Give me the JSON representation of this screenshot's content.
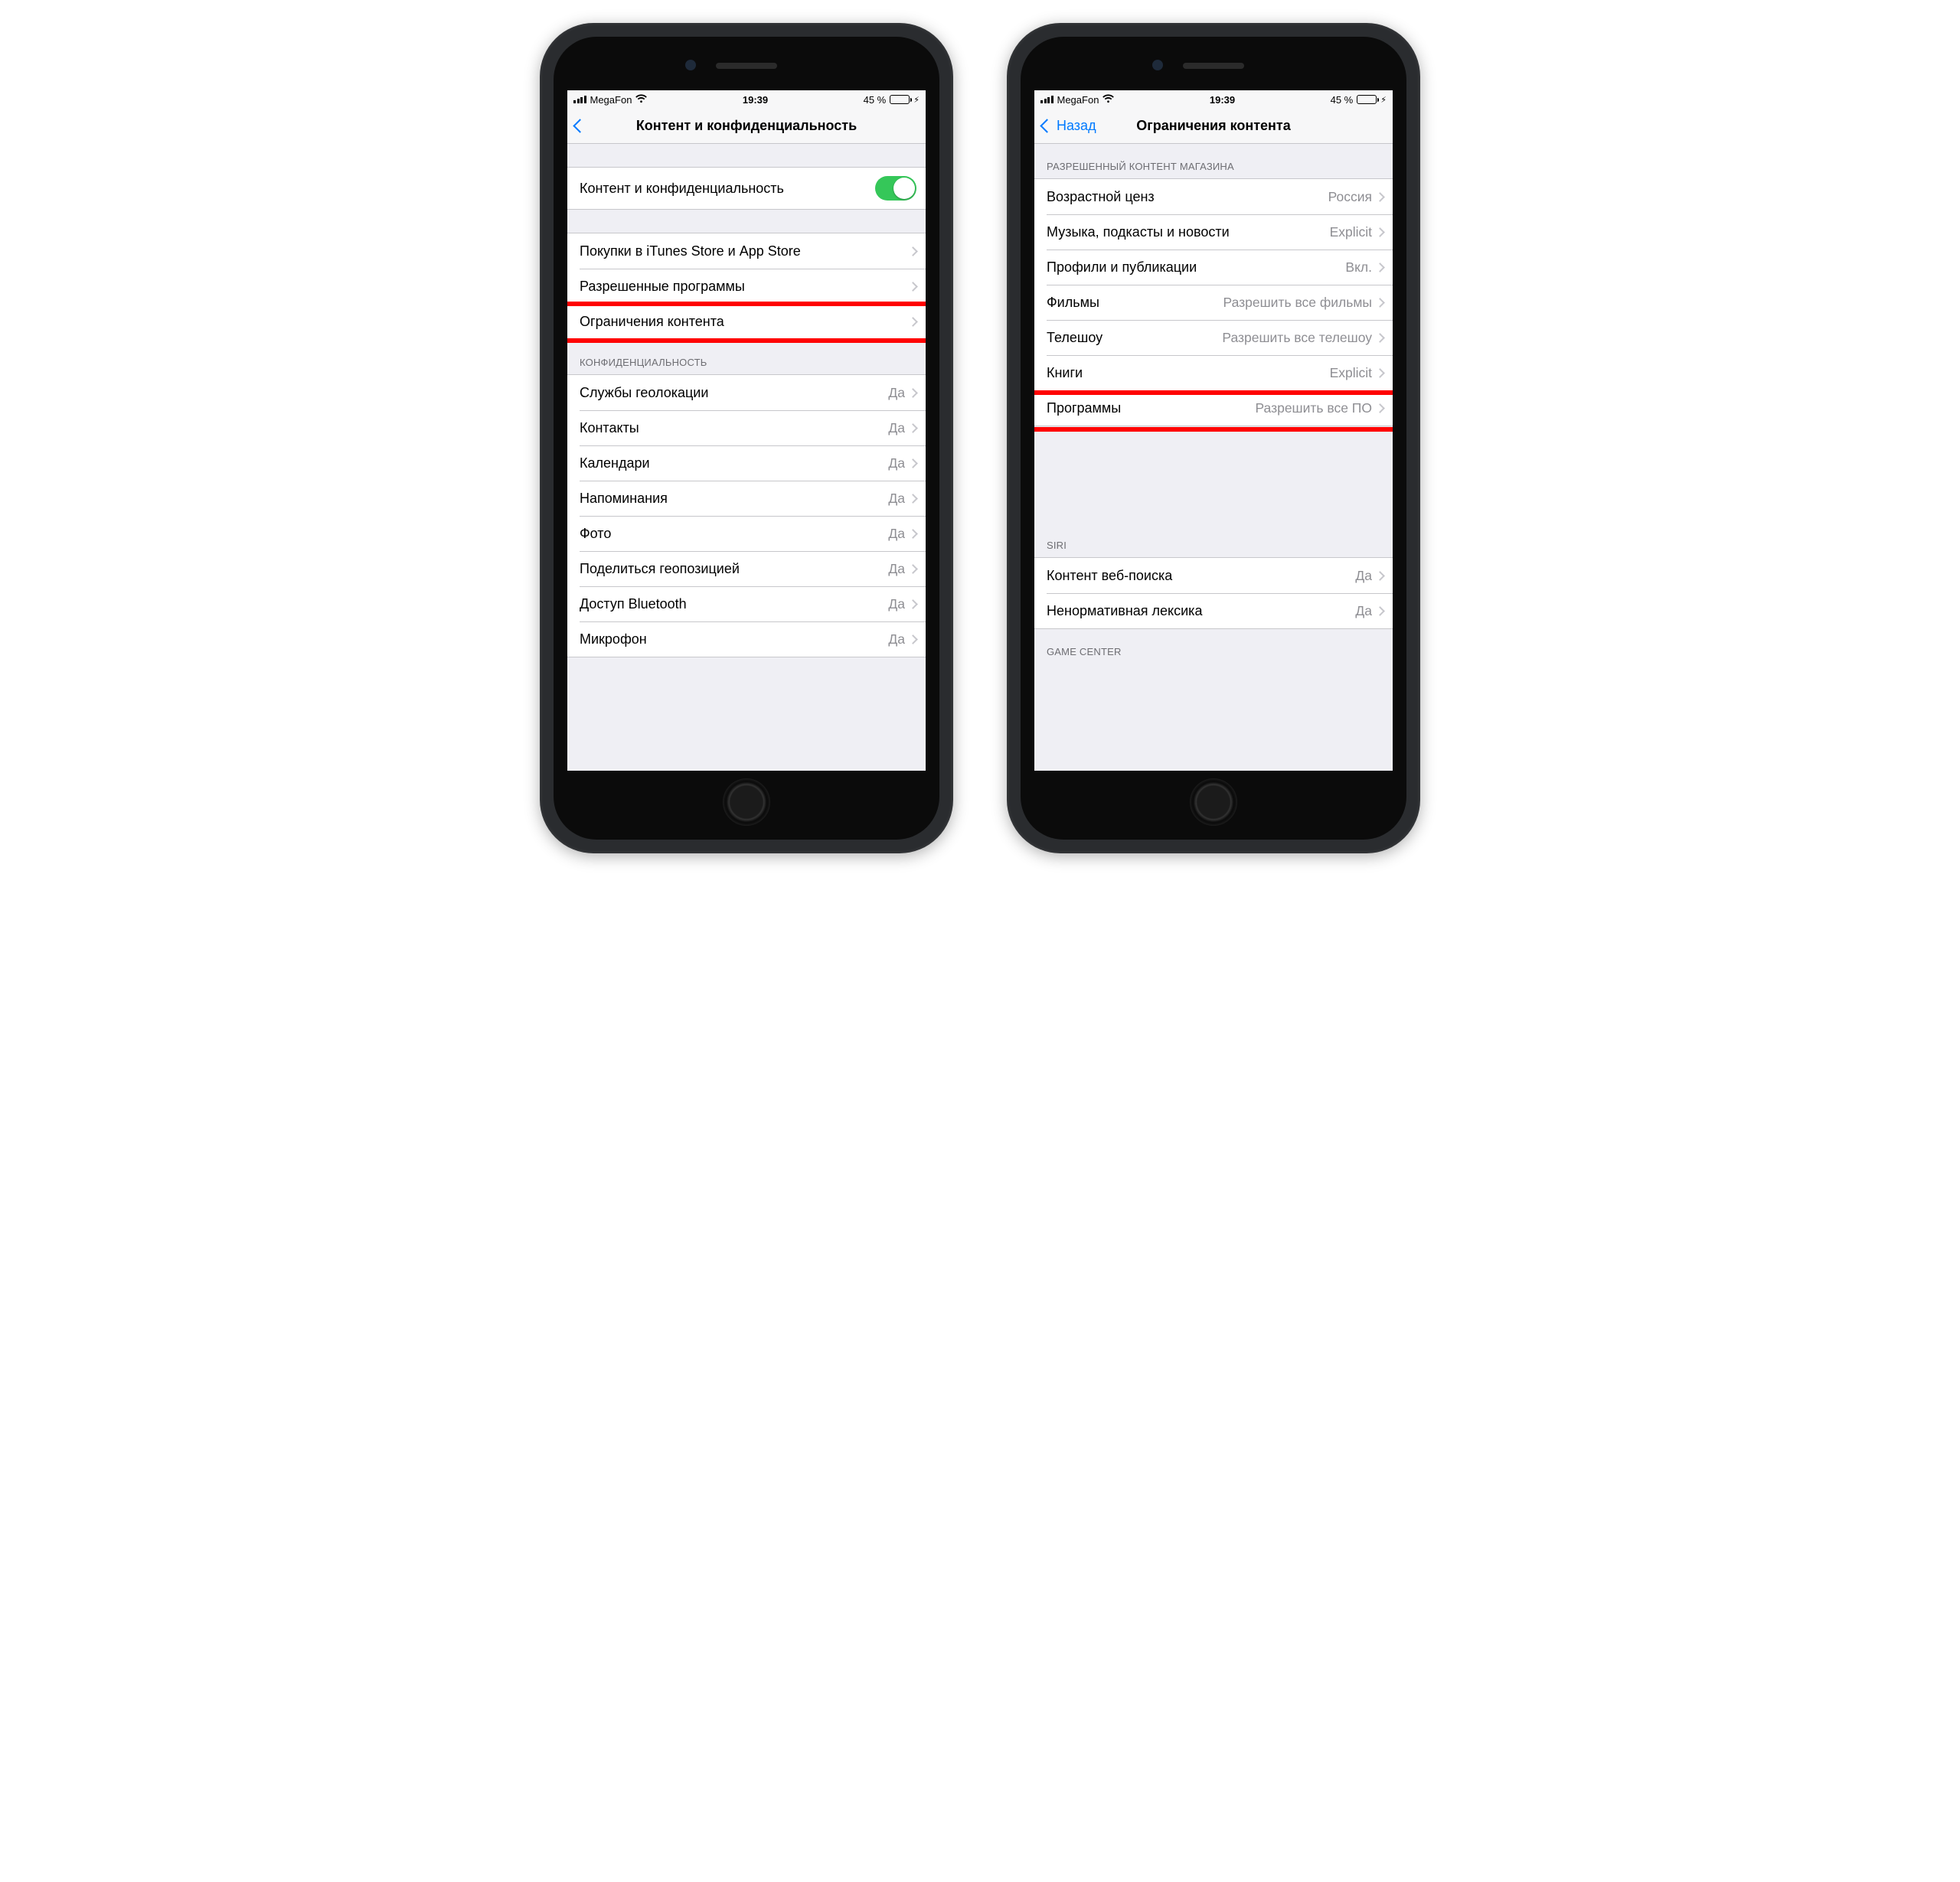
{
  "status": {
    "carrier": "MegaFon",
    "time": "19:39",
    "battery_pct": "45 %"
  },
  "left_phone": {
    "nav_title": "Контент и конфиденциальность",
    "toggle_row_label": "Контент и конфиденциальность",
    "group2": {
      "purchases": "Покупки в iTunes Store и App Store",
      "allowed_apps": "Разрешенные программы",
      "content_restrictions": "Ограничения контента"
    },
    "privacy_header": "КОНФИДЕНЦИАЛЬНОСТЬ",
    "privacy_rows": [
      {
        "label": "Службы геолокации",
        "value": "Да"
      },
      {
        "label": "Контакты",
        "value": "Да"
      },
      {
        "label": "Календари",
        "value": "Да"
      },
      {
        "label": "Напоминания",
        "value": "Да"
      },
      {
        "label": "Фото",
        "value": "Да"
      },
      {
        "label": "Поделиться геопозицией",
        "value": "Да"
      },
      {
        "label": "Доступ Bluetooth",
        "value": "Да"
      },
      {
        "label": "Микрофон",
        "value": "Да"
      }
    ]
  },
  "right_phone": {
    "back_label": "Назад",
    "nav_title": "Ограничения контента",
    "store_header": "РАЗРЕШЕННЫЙ КОНТЕНТ МАГАЗИНА",
    "store_rows": [
      {
        "label": "Возрастной ценз",
        "value": "Россия"
      },
      {
        "label": "Музыка, подкасты и новости",
        "value": "Explicit"
      },
      {
        "label": "Профили и публикации",
        "value": "Вкл."
      },
      {
        "label": "Фильмы",
        "value": "Разрешить все фильмы"
      },
      {
        "label": "Телешоу",
        "value": "Разрешить все телешоу"
      },
      {
        "label": "Книги",
        "value": "Explicit"
      },
      {
        "label": "Программы",
        "value": "Разрешить все ПО"
      }
    ],
    "siri_header": "SIRI",
    "siri_rows": [
      {
        "label": "Контент веб-поиска",
        "value": "Да"
      },
      {
        "label": "Ненормативная лексика",
        "value": "Да"
      }
    ],
    "gc_header": "GAME CENTER"
  }
}
